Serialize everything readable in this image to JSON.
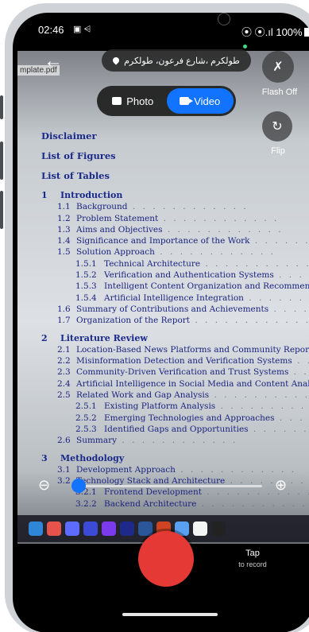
{
  "status_bar": {
    "time": "02:46",
    "left_icons": "▣ ⩤",
    "right_text": "⦿ ⦿.ıl 100%"
  },
  "camera": {
    "location_label": "طولكرم ،شارع فرعون، طولكرم",
    "flash_label": "Flash Off",
    "flip_label": "Flip",
    "modes": [
      {
        "label": "Photo",
        "active": false
      },
      {
        "label": "Video",
        "active": true
      }
    ],
    "zoom_level": 0.02,
    "record_label": "Tap",
    "record_sub": "to record"
  },
  "preview": {
    "file_label": "mplate.pdf",
    "front": [
      "Disclaimer",
      "List of Figures",
      "List of Tables"
    ],
    "chapters": [
      {
        "num": "1",
        "title": "Introduction",
        "items": [
          {
            "n": "1.1",
            "t": "Background"
          },
          {
            "n": "1.2",
            "t": "Problem Statement"
          },
          {
            "n": "1.3",
            "t": "Aims and Objectives"
          },
          {
            "n": "1.4",
            "t": "Significance and Importance of the Work"
          },
          {
            "n": "1.5",
            "t": "Solution Approach"
          },
          {
            "n": "1.5.1",
            "t": "Technical Architecture",
            "sub": true
          },
          {
            "n": "1.5.2",
            "t": "Verification and Authentication Systems",
            "sub": true
          },
          {
            "n": "1.5.3",
            "t": "Intelligent Content Organization and Recommend",
            "sub": true
          },
          {
            "n": "1.5.4",
            "t": "Artificial Intelligence Integration",
            "sub": true
          },
          {
            "n": "1.6",
            "t": "Summary of Contributions and Achievements"
          },
          {
            "n": "1.7",
            "t": "Organization of the Report"
          }
        ]
      },
      {
        "num": "2",
        "title": "Literature Review",
        "items": [
          {
            "n": "2.1",
            "t": "Location-Based News Platforms and Community Reportin"
          },
          {
            "n": "2.2",
            "t": "Misinformation Detection and Verification Systems"
          },
          {
            "n": "2.3",
            "t": "Community-Driven Verification and Trust Systems"
          },
          {
            "n": "2.4",
            "t": "Artificial Intelligence in Social Media and Content Analysis"
          },
          {
            "n": "2.5",
            "t": "Related Work and Gap Analysis"
          },
          {
            "n": "2.5.1",
            "t": "Existing Platform Analysis",
            "sub": true
          },
          {
            "n": "2.5.2",
            "t": "Emerging Technologies and Approaches",
            "sub": true
          },
          {
            "n": "2.5.3",
            "t": "Identified Gaps and Opportunities",
            "sub": true
          },
          {
            "n": "2.6",
            "t": "Summary"
          }
        ]
      },
      {
        "num": "3",
        "title": "Methodology",
        "items": [
          {
            "n": "3.1",
            "t": "Development Approach"
          },
          {
            "n": "3.2",
            "t": "Technology Stack and Architecture"
          },
          {
            "n": "3.2.1",
            "t": "Frontend Development",
            "sub": true
          },
          {
            "n": "3.2.2",
            "t": "Backend Architecture",
            "sub": true
          }
        ]
      }
    ],
    "dock_apps": [
      "vscode",
      "figma",
      "calendar",
      "teams",
      "canva",
      "premiere",
      "word",
      "powerpoint",
      "mail",
      "calendar-12",
      "appletv"
    ]
  },
  "colors": {
    "accent": "#1173ff",
    "record": "#e53935"
  }
}
